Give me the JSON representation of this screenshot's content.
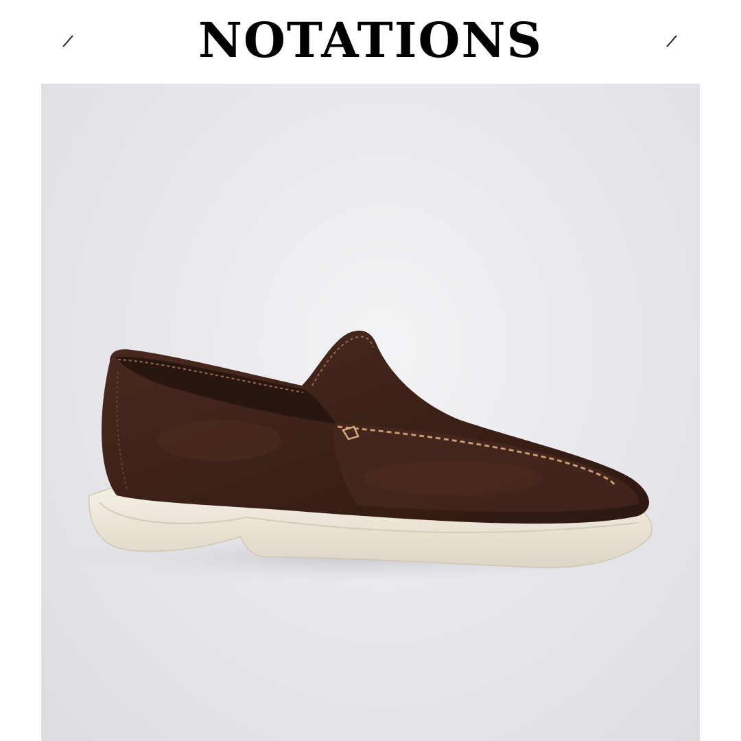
{
  "header": {
    "brand_title": "NOTATIONS",
    "left_mark_icon": "slash-mark-icon",
    "right_mark_icon": "slash-mark-icon"
  },
  "product_photo": {
    "subject": "loafer-shoe-illustration",
    "colors": {
      "background": "#e8e8ec",
      "suede": "#3a1f17",
      "suede_highlight": "#5a3326",
      "stitching": "#b88a66",
      "sole": "#efe9dc"
    }
  }
}
